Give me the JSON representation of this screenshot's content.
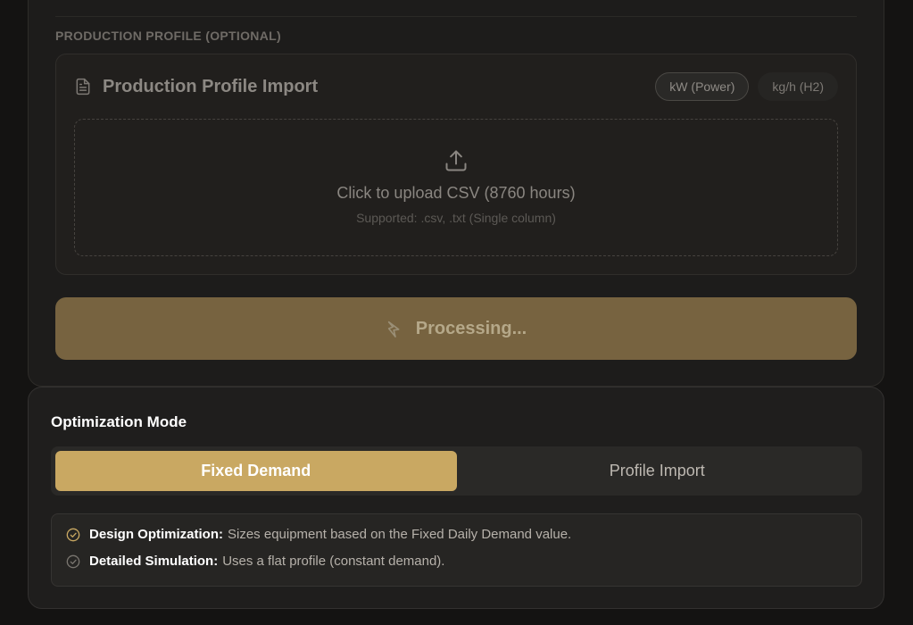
{
  "production_profile": {
    "section_label": "PRODUCTION PROFILE (OPTIONAL)",
    "title": "Production Profile Import",
    "title_icon": "document-icon",
    "units": [
      {
        "label": "kW (Power)",
        "active": true
      },
      {
        "label": "kg/h (H2)",
        "active": false
      }
    ],
    "dropzone": {
      "icon": "upload-icon",
      "title": "Click to upload CSV (8760 hours)",
      "subtitle": "Supported: .csv, .txt (Single column)"
    },
    "process_button": {
      "label": "Processing...",
      "icon": "sparkle-icon"
    }
  },
  "optimization": {
    "title": "Optimization Mode",
    "tabs": [
      {
        "label": "Fixed Demand",
        "active": true
      },
      {
        "label": "Profile Import",
        "active": false
      }
    ],
    "info": [
      {
        "key": "Design Optimization:",
        "value": "Sizes equipment based on the Fixed Daily Demand value.",
        "icon": "check-circle-icon",
        "color": "#c9a862"
      },
      {
        "key": "Detailed Simulation:",
        "value": "Uses a flat profile (constant demand).",
        "icon": "check-circle-icon",
        "color": "#7a7670"
      }
    ]
  },
  "colors": {
    "accent": "#c9a862",
    "accent_dimmed": "#776340",
    "background": "#141312"
  }
}
